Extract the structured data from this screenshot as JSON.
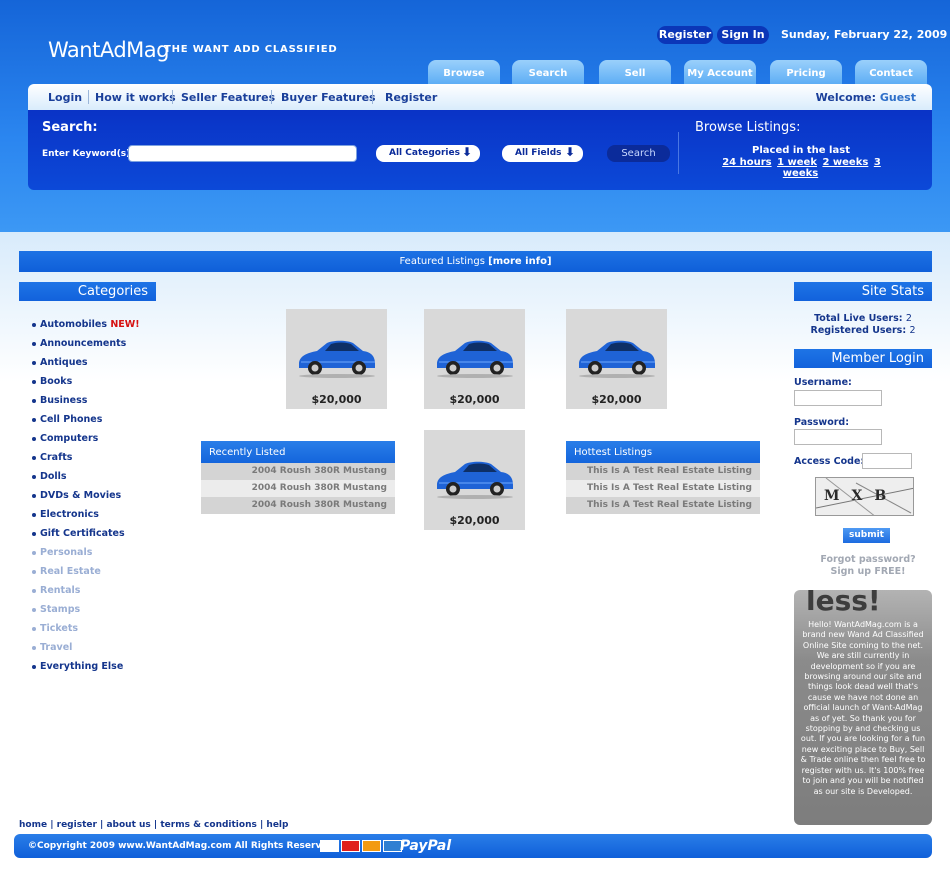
{
  "header": {
    "logo": "WantAdMag",
    "tagline": "THE WANT ADD CLASSIFIED",
    "register_label": "Register",
    "signin_label": "Sign In",
    "date": "Sunday, February 22, 2009"
  },
  "tabs": [
    "Browse",
    "Search",
    "Sell",
    "My Account",
    "Pricing",
    "Contact"
  ],
  "nav": {
    "links": [
      "Login",
      "How it works",
      "Seller Features",
      "Buyer Features",
      "Register"
    ],
    "welcome_prefix": "Welcome:",
    "welcome_user": "Guest"
  },
  "search": {
    "title": "Search:",
    "keyword_label": "Enter Keyword(s):",
    "keyword_value": "",
    "category_select": "All Categories",
    "field_select": "All Fields",
    "button": "Search"
  },
  "browse": {
    "title": "Browse Listings:",
    "subtitle": "Placed in the last",
    "links": [
      "24 hours",
      "1 week",
      "2 weeks",
      "3 weeks"
    ]
  },
  "featured": {
    "label": "Featured Listings ",
    "more": "[more info]"
  },
  "categories": {
    "title": "Categories",
    "new_badge": "NEW!",
    "items": [
      {
        "label": "Automobiles ",
        "active": true,
        "new": true
      },
      {
        "label": "Announcements",
        "active": true
      },
      {
        "label": "Antiques",
        "active": true
      },
      {
        "label": "Books",
        "active": true
      },
      {
        "label": "Business",
        "active": true
      },
      {
        "label": "Cell Phones",
        "active": true
      },
      {
        "label": "Computers",
        "active": true
      },
      {
        "label": "Crafts",
        "active": true
      },
      {
        "label": "Dolls",
        "active": true
      },
      {
        "label": "DVDs & Movies",
        "active": true
      },
      {
        "label": "Electronics",
        "active": true
      },
      {
        "label": "Gift Certificates",
        "active": true
      },
      {
        "label": "Personals",
        "active": false
      },
      {
        "label": "Real Estate",
        "active": false
      },
      {
        "label": "Rentals",
        "active": false
      },
      {
        "label": "Stamps",
        "active": false
      },
      {
        "label": "Tickets",
        "active": false
      },
      {
        "label": "Travel",
        "active": false
      },
      {
        "label": "Everything Else",
        "active": true
      }
    ]
  },
  "listings": {
    "prices": [
      "$20,000",
      "$20,000",
      "$20,000",
      "$20,000"
    ],
    "car_color": "#1f63d6"
  },
  "recent": {
    "title": "Recently Listed",
    "rows": [
      "2004 Roush 380R Mustang",
      "2004 Roush 380R Mustang",
      "2004 Roush 380R Mustang"
    ]
  },
  "hottest": {
    "title": "Hottest Listings",
    "rows": [
      "This Is A Test Real Estate Listing",
      "This Is A Test Real Estate Listing",
      "This Is A Test Real Estate Listing"
    ]
  },
  "site_stats": {
    "title": "Site Stats",
    "live_label": "Total Live Users:",
    "live_value": "2",
    "registered_label": "Registered Users:",
    "registered_value": "2"
  },
  "login": {
    "title": "Member Login",
    "username_label": "Username:",
    "password_label": "Password:",
    "access_label": "Access Code:",
    "captcha": "MXB",
    "submit": "submit",
    "forgot": "Forgot password?",
    "signup": "Sign up FREE!"
  },
  "info_box": {
    "deco": "less!",
    "text": "Hello! WantAdMag.com is a brand new Wand Ad Classified Online Site coming to the net. We are still currently in development so if you are browsing around our site and things look dead well that's cause we have not done an official launch of Want-AdMag as of yet. So thank you for stopping by and checking us out. If you are looking for a fun new exciting place to Buy, Sell & Trade online then feel free to register with us. It's 100% free to join and you will be notified as our site is Developed."
  },
  "footer": {
    "links": [
      "home",
      "register",
      "about us",
      "terms & conditions",
      "help"
    ],
    "copyright": "©Copyright 2009 www.WantAdMag.com All Rights Reserved.",
    "paypal": "PayPal"
  }
}
